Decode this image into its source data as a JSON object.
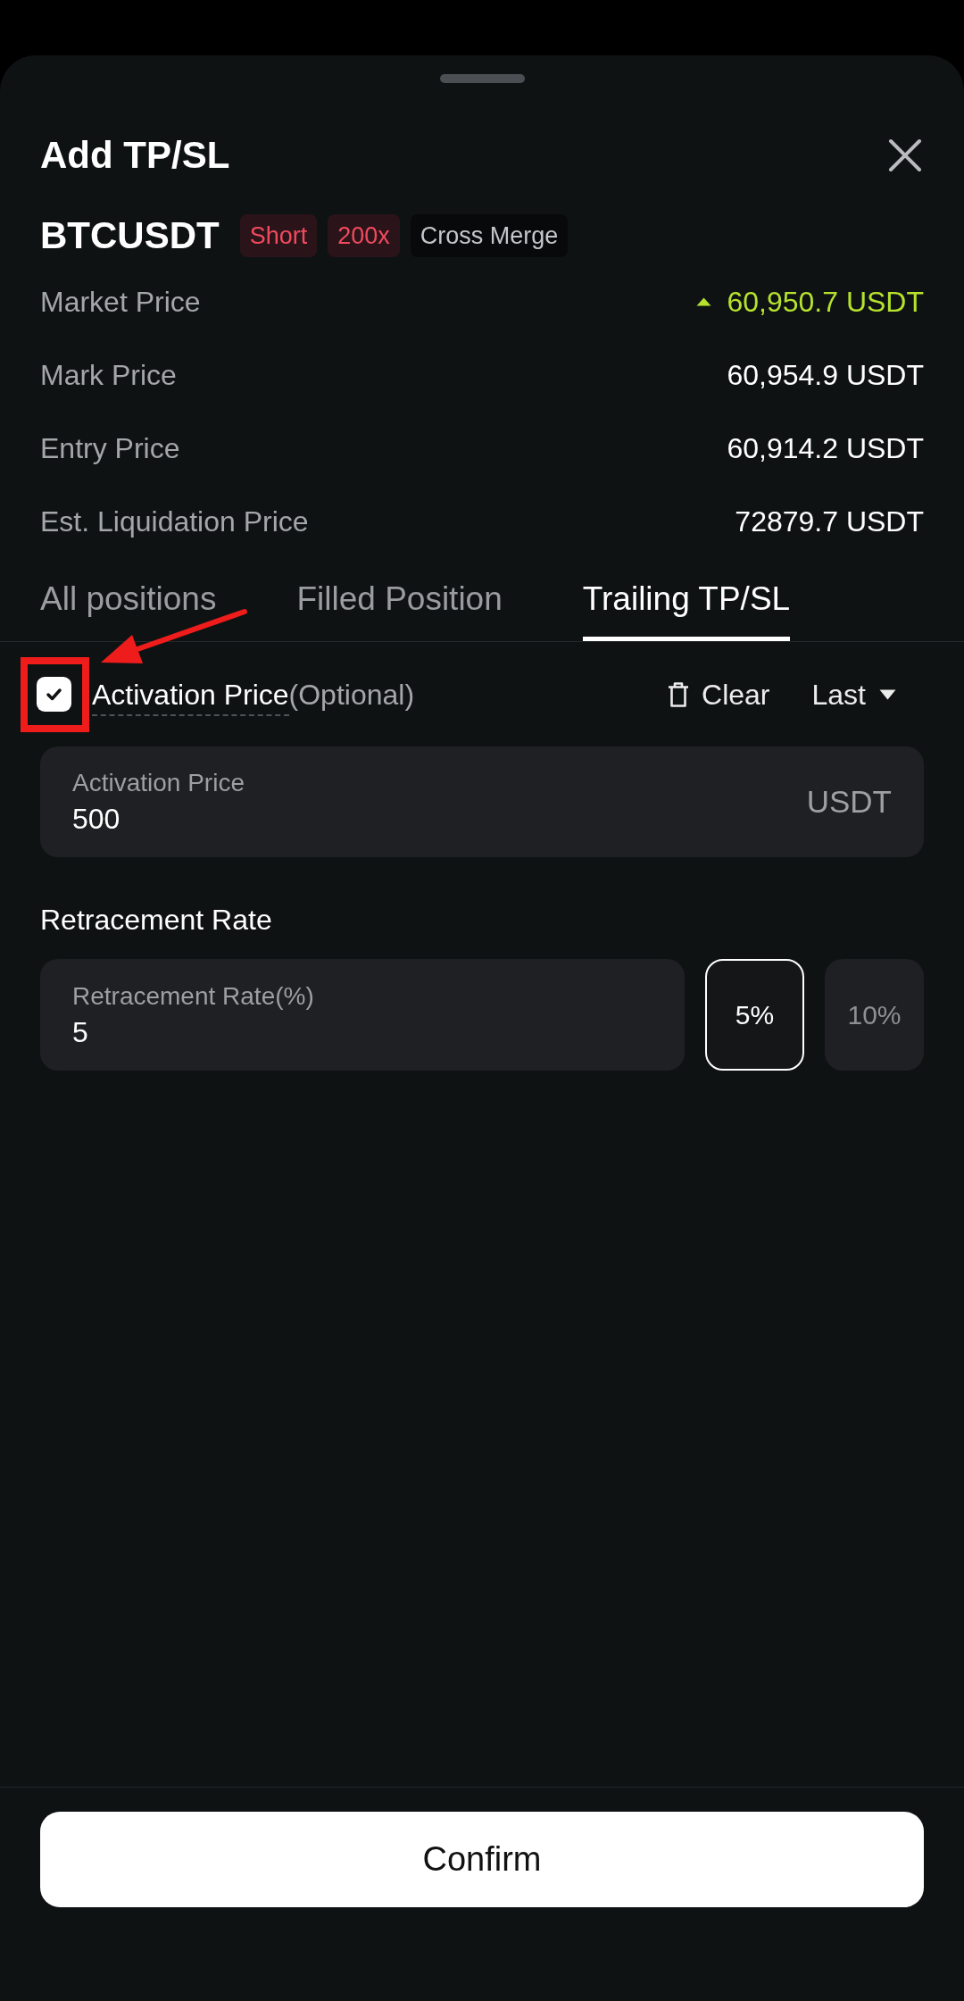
{
  "sheet": {
    "title": "Add TP/SL"
  },
  "position": {
    "symbol": "BTCUSDT",
    "tags": [
      {
        "label": "Short",
        "kind": "accent"
      },
      {
        "label": "200x",
        "kind": "accent"
      },
      {
        "label": "Cross Merge",
        "kind": "plain"
      }
    ]
  },
  "prices": [
    {
      "label": "Market Price",
      "value": "60,950.7 USDT",
      "rising": true
    },
    {
      "label": "Mark Price",
      "value": "60,954.9 USDT",
      "rising": false
    },
    {
      "label": "Entry Price",
      "value": "60,914.2 USDT",
      "rising": false
    },
    {
      "label": "Est. Liquidation Price",
      "value": "72879.7 USDT",
      "rising": false
    }
  ],
  "tabs": [
    {
      "label": "All positions",
      "selected": false
    },
    {
      "label": "Filled Position",
      "selected": false
    },
    {
      "label": "Trailing TP/SL",
      "selected": true
    }
  ],
  "activation": {
    "checked": true,
    "label": "Activation Price",
    "hint": "(Optional)",
    "clear_label": "Clear",
    "price_type": "Last",
    "field": {
      "label": "Activation Price",
      "value": "500",
      "unit": "USDT"
    }
  },
  "annotation": {
    "kind": "frame-and-arrow"
  },
  "retracement": {
    "title": "Retracement Rate",
    "field": {
      "label": "Retracement Rate(%)",
      "value": "5"
    },
    "presets": [
      {
        "label": "5%",
        "selected": true
      },
      {
        "label": "10%",
        "selected": false
      }
    ]
  },
  "confirm_label": "Confirm"
}
